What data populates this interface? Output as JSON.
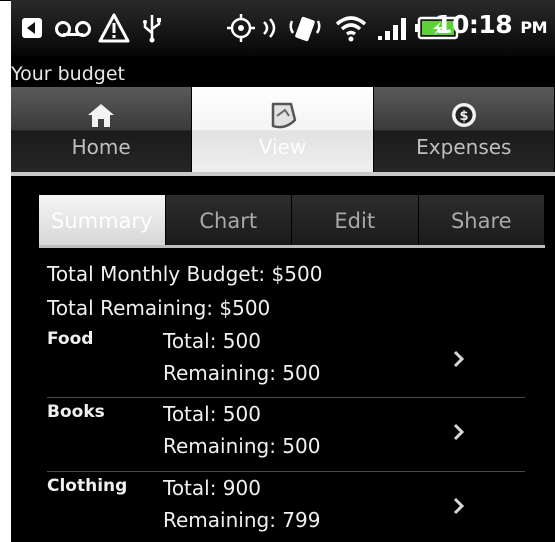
{
  "status_bar": {
    "time": "10:18",
    "ampm": "PM",
    "icons": [
      "back-arrow-icon",
      "voicemail-icon",
      "warning-icon",
      "usb-icon",
      "gps-icon",
      "vibrate-icon",
      "wifi-icon",
      "signal-icon",
      "battery-charging-icon"
    ]
  },
  "app": {
    "title": "Your budget"
  },
  "main_tabs": [
    {
      "label": "Home",
      "icon": "home-icon",
      "active": false
    },
    {
      "label": "View",
      "icon": "view-icon",
      "active": true
    },
    {
      "label": "Expenses",
      "icon": "dollar-coin-icon",
      "active": false
    }
  ],
  "sub_tabs": [
    {
      "label": "Summary",
      "active": true
    },
    {
      "label": "Chart",
      "active": false
    },
    {
      "label": "Edit",
      "active": false
    },
    {
      "label": "Share",
      "active": false
    }
  ],
  "summary": {
    "total_monthly_budget": "Total Monthly Budget: $500",
    "total_remaining": "Total Remaining: $500"
  },
  "categories": [
    {
      "name": "Food",
      "total": "Total: 500",
      "remaining": "Remaining: 500"
    },
    {
      "name": "Books",
      "total": "Total: 500",
      "remaining": "Remaining: 500"
    },
    {
      "name": "Clothing",
      "total": "Total: 900",
      "remaining": "Remaining: 799"
    }
  ],
  "colors": {
    "background": "#000000",
    "text": "#f0f0f0",
    "tab_inactive": "#262626",
    "tab_active": "#f4f4f4",
    "battery_green": "#5fd03a"
  }
}
